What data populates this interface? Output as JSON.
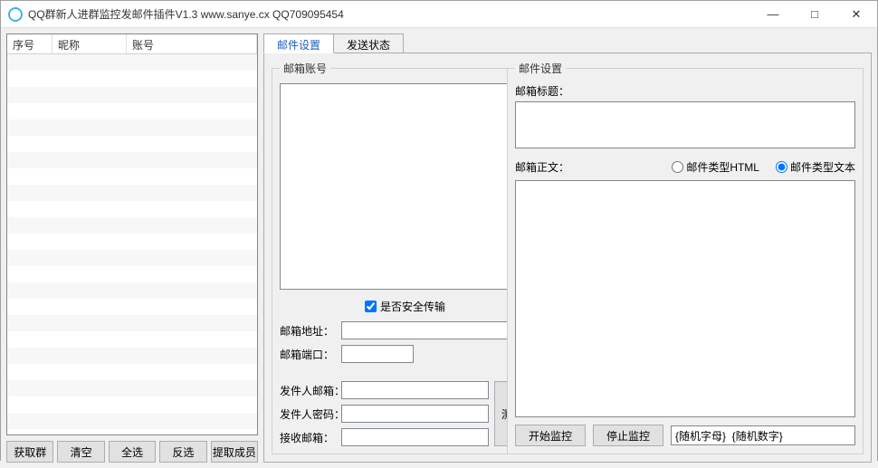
{
  "window": {
    "title": "QQ群新人进群监控发邮件插件V1.3       www.sanye.cx       QQ709095454"
  },
  "left": {
    "columns": {
      "c1": "序号",
      "c2": "昵称",
      "c3": "账号"
    },
    "buttons": {
      "fetch_group": "获取群",
      "clear": "清空",
      "select_all": "全选",
      "invert": "反选",
      "extract_members": "提取成员"
    }
  },
  "tabs": {
    "mail_settings": "邮件设置",
    "send_status": "发送状态"
  },
  "mail": {
    "account_legend": "邮箱账号",
    "secure_label": "是否安全传输",
    "secure_checked": true,
    "address_label": "邮箱地址：",
    "port_label": "邮箱端口：",
    "sender_email_label": "发件人邮箱：",
    "sender_pwd_label": "发件人密码：",
    "recv_label": "接收邮箱：",
    "test_btn": "测试",
    "address_value": "",
    "port_value": "",
    "sender_email_value": "",
    "sender_pwd_value": "",
    "recv_value": "",
    "accounts_value": ""
  },
  "settings": {
    "legend": "邮件设置",
    "title_label": "邮箱标题：",
    "title_value": "",
    "body_label": "邮箱正文：",
    "body_value": "",
    "radio_html": "邮件类型HTML",
    "radio_text": "邮件类型文本",
    "radio_selected": "text",
    "start_btn": "开始监控",
    "stop_btn": "停止监控",
    "template_value": "{随机字母}  {随机数字}"
  }
}
